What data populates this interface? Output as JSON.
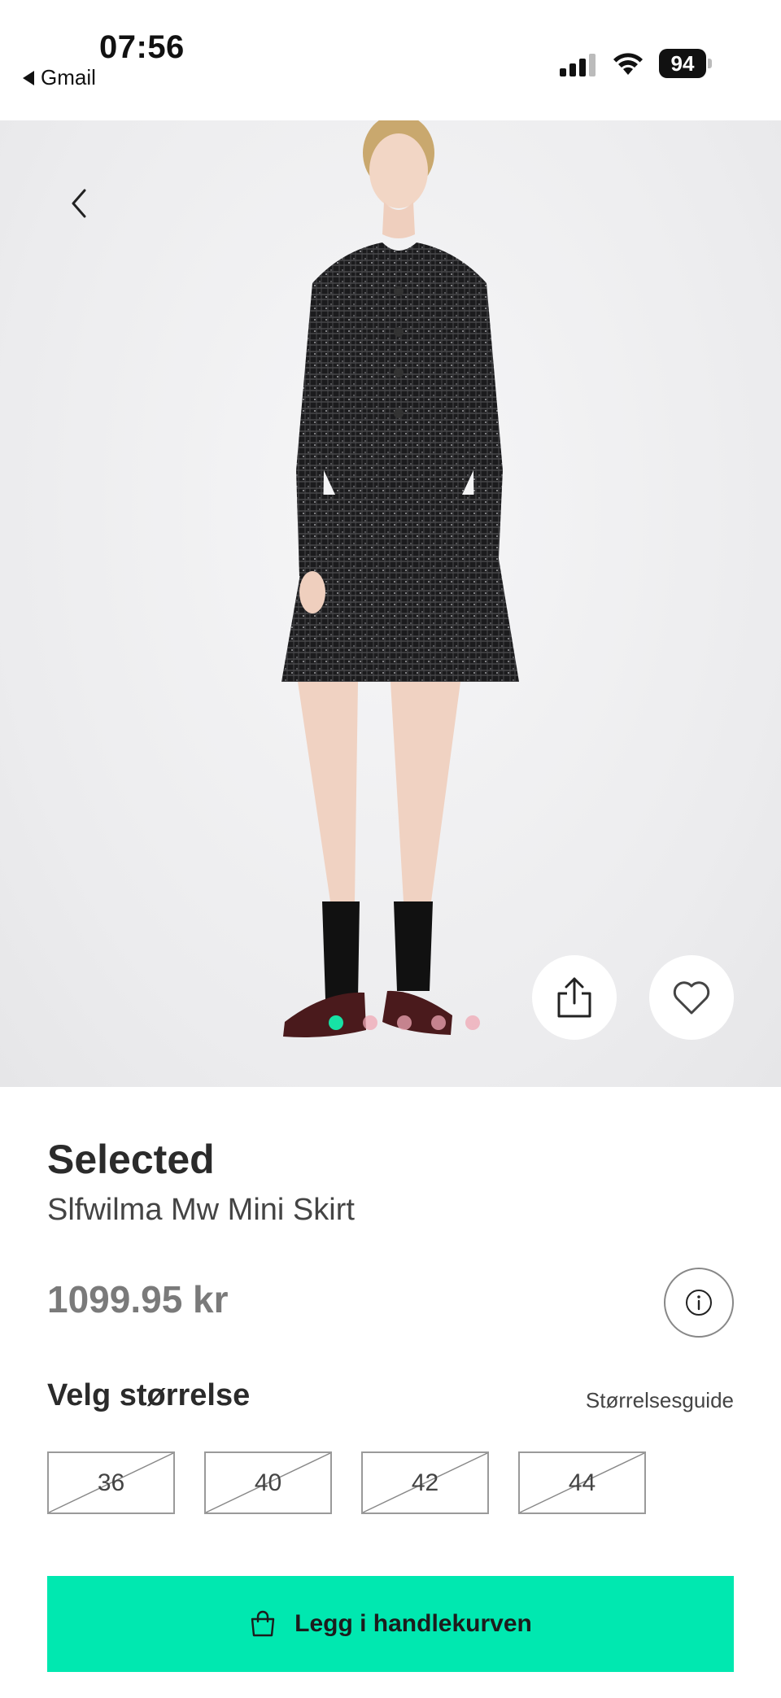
{
  "status_bar": {
    "time": "07:56",
    "back_app": "Gmail",
    "battery": "94"
  },
  "hero": {
    "image_count": 5,
    "active_index": 0,
    "icons": {
      "back": "chevron-left-icon",
      "share": "share-icon",
      "favorite": "heart-icon"
    }
  },
  "product": {
    "brand": "Selected",
    "name": "Slfwilma Mw Mini Skirt",
    "price": "1099.95 kr"
  },
  "size": {
    "heading": "Velg størrelse",
    "guide_link": "Størrelsesguide",
    "options": [
      {
        "label": "36",
        "available": false
      },
      {
        "label": "40",
        "available": false
      },
      {
        "label": "42",
        "available": false
      },
      {
        "label": "44",
        "available": false
      }
    ]
  },
  "cart": {
    "label": "Legg i handlekurven"
  },
  "colors": {
    "accent": "#00e8b0",
    "dot_active": "#17e2a5",
    "dot_inactive": "#efa7b4"
  }
}
